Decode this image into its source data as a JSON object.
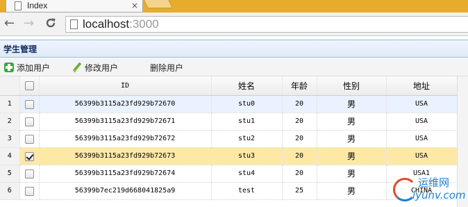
{
  "browser": {
    "tab_title": "Index",
    "tab_close": "×",
    "url_host": "localhost",
    "url_port": ":3000",
    "back_glyph": "←",
    "forward_glyph": "→",
    "reload_glyph": "C"
  },
  "panel": {
    "title": "学生管理"
  },
  "toolbar": {
    "add_label": "添加用户",
    "edit_label": "修改用户",
    "delete_label": "删除用户"
  },
  "grid": {
    "columns": [
      "ID",
      "姓名",
      "年龄",
      "性别",
      "地址"
    ],
    "rows": [
      {
        "rownum": "1",
        "id": "56399b3115a23fd929b72670",
        "name": "stu0",
        "age": "20",
        "sex": "男",
        "address": "USA",
        "checked": false,
        "state": "hover"
      },
      {
        "rownum": "2",
        "id": "56399b3115a23fd929b72671",
        "name": "stu1",
        "age": "20",
        "sex": "男",
        "address": "USA",
        "checked": false,
        "state": "normal"
      },
      {
        "rownum": "3",
        "id": "56399b3115a23fd929b72672",
        "name": "stu2",
        "age": "20",
        "sex": "男",
        "address": "USA",
        "checked": false,
        "state": "normal"
      },
      {
        "rownum": "4",
        "id": "56399b3115a23fd929b72673",
        "name": "stu3",
        "age": "20",
        "sex": "男",
        "address": "USA",
        "checked": true,
        "state": "selected"
      },
      {
        "rownum": "5",
        "id": "56399b3115a23fd929b72674",
        "name": "stu4",
        "age": "20",
        "sex": "男",
        "address": "USA1",
        "checked": false,
        "state": "normal"
      },
      {
        "rownum": "6",
        "id": "56399b7ec219d668041825a9",
        "name": "test",
        "age": "25",
        "sex": "男",
        "address": "CHINA",
        "checked": false,
        "state": "normal"
      }
    ]
  },
  "watermark": {
    "cn": "运维网",
    "en": "iyunv.com"
  },
  "colors": {
    "tabstrip": "#e9ab2b",
    "panel_header_border": "#95b8e7",
    "selected_row": "#fde8a6",
    "hover_row": "#eaf2ff"
  }
}
